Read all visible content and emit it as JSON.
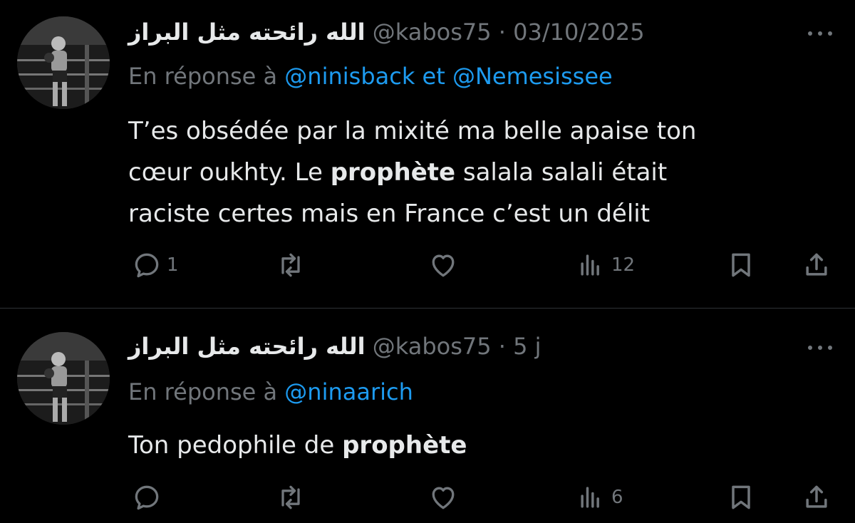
{
  "tweets": [
    {
      "display_name": "الله رائحته مثل البراز",
      "handle": "@kabos75",
      "separator": "·",
      "timestamp": "03/10/2025",
      "reply_prefix": "En réponse à",
      "reply_mention_1": "@ninisback",
      "reply_joiner": "et",
      "reply_mention_2": "@Nemesissee",
      "body_line1": "T’es obsédée par la mixité ma belle apaise ton",
      "body_line2_a": "cœur oukhty. Le ",
      "body_line2_bold": "prophète",
      "body_line2_b": " salala salali était",
      "body_line3": "raciste certes mais en France c’est un délit",
      "reply_count": "1",
      "retweet_count": "",
      "like_count": "",
      "view_count": "12"
    },
    {
      "display_name": "الله رائحته مثل البراز",
      "handle": "@kabos75",
      "separator": "·",
      "timestamp": "5 j",
      "reply_prefix": "En réponse à",
      "reply_mention_1": "@ninaarich",
      "body_a": "Ton pedophile de ",
      "body_bold": "prophète",
      "reply_count": "",
      "retweet_count": "",
      "like_count": "",
      "view_count": "6"
    }
  ],
  "icons": {
    "reply": "reply-icon",
    "retweet": "retweet-icon",
    "like": "heart-icon",
    "views": "views-icon",
    "bookmark": "bookmark-icon",
    "share": "share-icon",
    "more": "more-icon"
  },
  "colors": {
    "background": "#000000",
    "text": "#e7e9ea",
    "muted": "#71767b",
    "link": "#1d9bf0",
    "divider": "#2f3336"
  }
}
